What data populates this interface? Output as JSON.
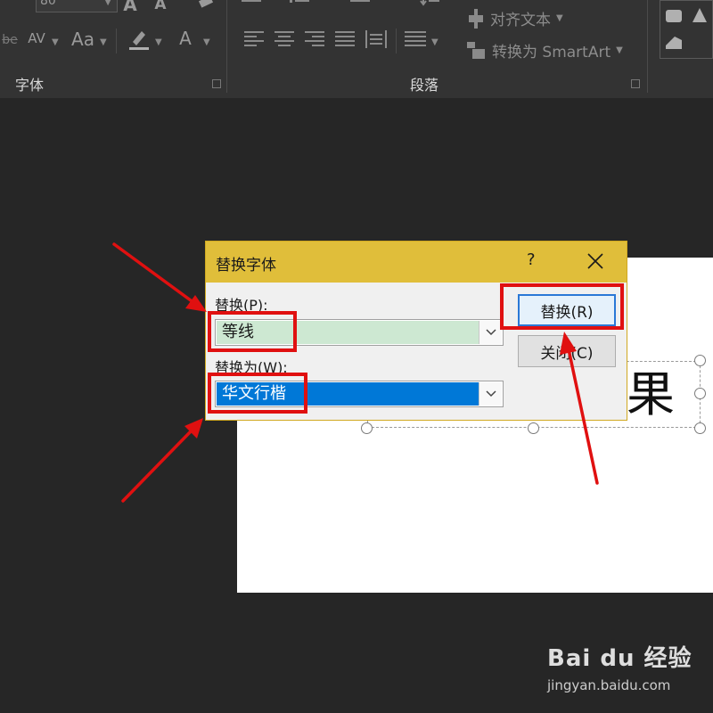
{
  "ribbon": {
    "font_group_label": "字体",
    "paragraph_group_label": "段落",
    "font_size": "80",
    "char_spacing_label": "AV",
    "change_case_label": "Aa",
    "font_color_label": "A",
    "grow_font_label": "A",
    "align_text_label": "对齐文本",
    "smartart_label": "转换为 SmartArt"
  },
  "dialog": {
    "title": "替换字体",
    "help": "?",
    "replace_label": "替换(P):",
    "replace_value": "等线",
    "replace_with_label": "替换为(W):",
    "replace_with_value": "华文行楷",
    "replace_button": "替换(R)",
    "close_button": "关闭(C)"
  },
  "slide": {
    "visible_text": "果"
  },
  "watermark": {
    "logo": "Bai du 经验",
    "url": "jingyan.baidu.com"
  },
  "colors": {
    "titlebar": "#e0be3a",
    "replace_field_bg": "#cde8d2",
    "replace_with_field_bg": "#0078d7",
    "annotation": "#e01010",
    "primary_button_border": "#2a78d6"
  }
}
